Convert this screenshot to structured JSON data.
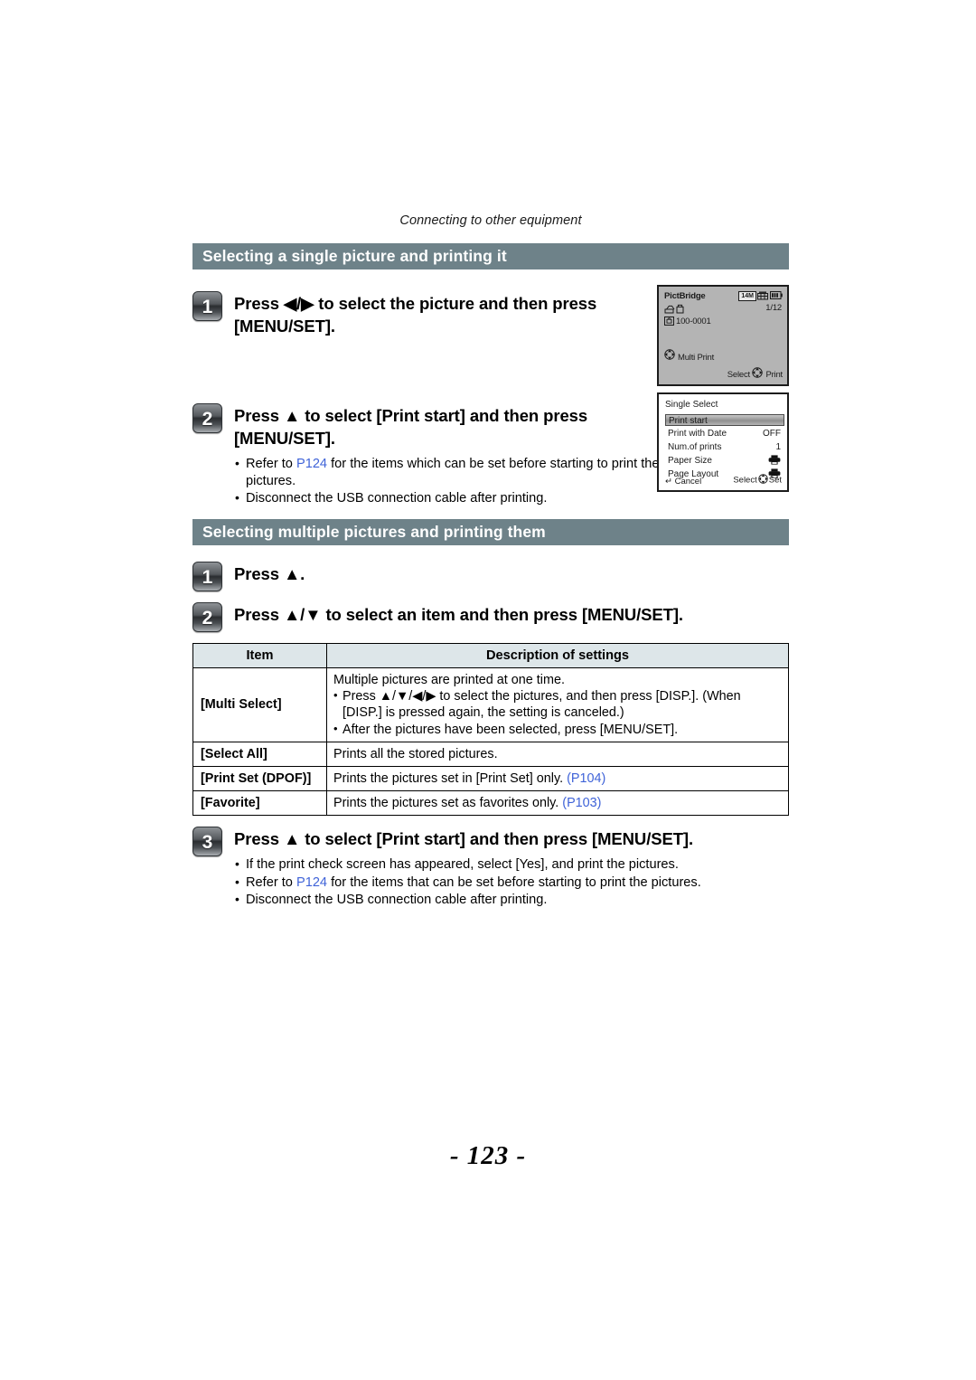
{
  "running_head": "Connecting to other equipment",
  "page_number": "- 123 -",
  "colors": {
    "section_bar": "#6e8289",
    "table_header": "#dde6e9",
    "reference_link": "#3f63d8"
  },
  "sections": [
    {
      "id": "single",
      "title": "Selecting a single picture and printing it",
      "steps": [
        {
          "number": "1",
          "title": "Press ◀/▶ to select the picture and then press [MENU/SET].",
          "bullets": []
        },
        {
          "number": "2",
          "title": "Press ▲ to select [Print start] and then press [MENU/SET].",
          "bullets": [
            {
              "pre": "Refer to ",
              "ref": "P124",
              "post": " for the items which can be set before starting to print the pictures."
            },
            {
              "pre": "Disconnect the USB connection cable after printing.",
              "ref": "",
              "post": ""
            }
          ]
        }
      ]
    },
    {
      "id": "multiple",
      "title": "Selecting multiple pictures and printing them",
      "steps": [
        {
          "number": "1",
          "title": "Press ▲.",
          "bullets": []
        },
        {
          "number": "2",
          "title": "Press ▲/▼ to select an item and then press [MENU/SET].",
          "bullets": []
        },
        {
          "number": "3",
          "title": "Press ▲ to select [Print start] and then press [MENU/SET].",
          "bullets": [
            {
              "pre": "If the print check screen has appeared, select [Yes], and print the pictures.",
              "ref": "",
              "post": ""
            },
            {
              "pre": "Refer to ",
              "ref": "P124",
              "post": " for the items that can be set before starting to print the pictures."
            },
            {
              "pre": "Disconnect the USB connection cable after printing.",
              "ref": "",
              "post": ""
            }
          ]
        }
      ]
    }
  ],
  "table": {
    "headers": [
      "Item",
      "Description of settings"
    ],
    "rows": [
      {
        "item": "[Multi Select]",
        "lead": "Multiple pictures are printed at one time.",
        "bullet1": "Press ▲/▼/◀/▶ to select the pictures, and then press [DISP.]. (When",
        "bullet1_cont": "[DISP.] is pressed again, the setting is canceled.)",
        "bullet2": "After the pictures have been selected, press [MENU/SET].",
        "desc": "",
        "ref": ""
      },
      {
        "item": "[Select All]",
        "lead": "",
        "bullet1": "",
        "bullet1_cont": "",
        "bullet2": "",
        "desc": "Prints all the stored pictures.",
        "ref": ""
      },
      {
        "item": "[Print Set (DPOF)]",
        "lead": "",
        "bullet1": "",
        "bullet1_cont": "",
        "bullet2": "",
        "desc": "Prints the pictures set in [Print Set] only. ",
        "ref": "(P104)"
      },
      {
        "item": "[Favorite]",
        "lead": "",
        "bullet1": "",
        "bullet1_cont": "",
        "bullet2": "",
        "desc": "Prints the pictures set as favorites only. ",
        "ref": "(P103)"
      }
    ]
  },
  "lcd_pictbridge": {
    "title": "PictBridge",
    "resolution_chip": "14M",
    "counter": "1/12",
    "file_number": "100-0001",
    "multi_print_label": "Multi Print",
    "footer_select": "Select",
    "footer_print": "Print"
  },
  "lcd_menu": {
    "title": "Single Select",
    "rows": [
      {
        "name": "Print start",
        "value": "",
        "selected": true,
        "icon": ""
      },
      {
        "name": "Print with Date",
        "value": "OFF",
        "selected": false,
        "icon": ""
      },
      {
        "name": "Num.of prints",
        "value": "1",
        "selected": false,
        "icon": ""
      },
      {
        "name": "Paper Size",
        "value": "",
        "selected": false,
        "icon": "printer-icon"
      },
      {
        "name": "Page Layout",
        "value": "",
        "selected": false,
        "icon": "printer-icon"
      }
    ],
    "footer_cancel": "Cancel",
    "footer_select": "Select",
    "footer_set": "Set"
  }
}
